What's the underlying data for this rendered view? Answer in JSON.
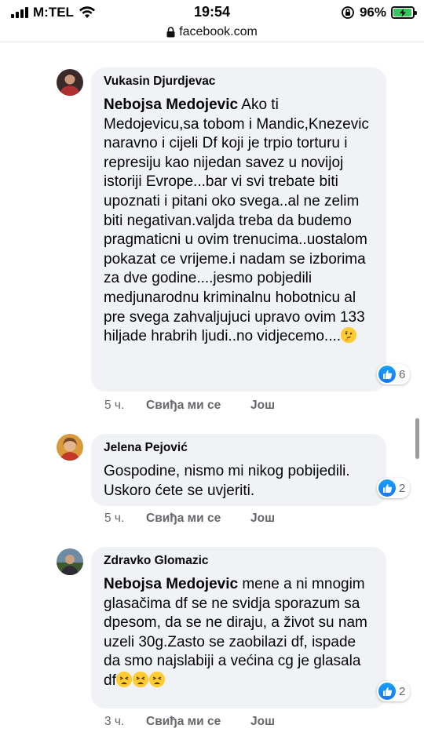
{
  "status_bar": {
    "carrier": "M:TEL",
    "time": "19:54",
    "battery_percent": "96%",
    "battery_level": 0.96
  },
  "url_bar": {
    "domain": "facebook.com"
  },
  "comments": [
    {
      "author": "Vukasin Djurdjevac",
      "mention": "Nebojsa Medojevic",
      "text": " Ako ti Medojevicu,sa tobom i Mandic,Knezevic naravno i cijeli Df koji je trpio torturu i represiju kao nijedan savez u novijoj istoriji Evrope...bar vi svi trebate biti upoznati i pitani oko svega..al ne zelim biti negativan.valjda treba da budemo pragmaticni u ovim trenucima..uostalom pokazat ce vrijeme.i nadam se izborima za dve godine....jesmo pobjedili medjunarodnu kriminalnu hobotnicu al pre svega zahvaljujuci upravo ovim 133 hiljade hrabrih ljudi..no vidjecemo....",
      "emoji": "thinking-face",
      "reaction_count": "6",
      "time": "5 ч.",
      "like_label": "Свиђа ми се",
      "more_label": "Још"
    },
    {
      "author": "Jelena Pejović",
      "mention": "",
      "text": "Gospodine, nismo mi nikog pobijedili. Uskoro ćete se uvjeriti.",
      "emoji": "",
      "reaction_count": "2",
      "time": "5 ч.",
      "like_label": "Свиђа ми се",
      "more_label": "Још"
    },
    {
      "author": "Zdravko Glomazic",
      "mention": "Nebojsa Medojevic",
      "text": " mene a ni mnogim glasačima df se ne svidja sporazum sa dpesom, da se ne diraju, a život su nam uzeli 30g.Zasto se zaobilazi df, ispade da smo najslabiji a većina cg je glasala df",
      "emoji": "tired-face x3",
      "reaction_count": "2",
      "time": "3 ч.",
      "like_label": "Свиђа ми се",
      "more_label": "Још"
    }
  ],
  "colors": {
    "bubble": "#f0f2f5",
    "meta_text": "#65676b",
    "like_blue": "#1877f2",
    "battery_green": "#34c759"
  }
}
